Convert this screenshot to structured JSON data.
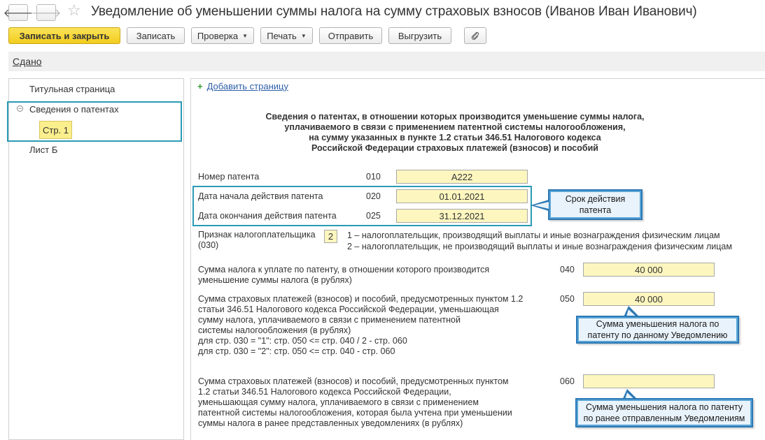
{
  "window": {
    "title": "Уведомление об уменьшении суммы налога на сумму страховых взносов (Иванов Иван Иванович)",
    "back_glyph": "🡐",
    "forward_glyph": "🡒",
    "star_glyph": "☆"
  },
  "toolbar": {
    "save_close": "Записать и закрыть",
    "save": "Записать",
    "check": "Проверка",
    "print": "Печать",
    "send": "Отправить",
    "export": "Выгрузить",
    "attach_icon": "paperclip-icon"
  },
  "status": {
    "link": "Сдано"
  },
  "nav": {
    "items": [
      {
        "label": "Титульная страница"
      },
      {
        "label": "Сведения о патентах",
        "collapse_glyph": "⊖"
      },
      {
        "label": "Стр. 1"
      },
      {
        "label": "Лист Б"
      }
    ]
  },
  "form": {
    "add_page": "Добавить страницу",
    "add_glyph": "+",
    "heading": [
      "Сведения о патентах, в отношении которых производится уменьшение суммы налога,",
      "уплачиваемого в связи с применением патентной системы налогообложения,",
      "на сумму указанных в пункте 1.2 статьи 346.51 Налогового кодекса",
      "Российской Федерации страховых платежей (взносов) и пособий"
    ],
    "patent_number": {
      "label": "Номер патента",
      "code": "010",
      "value": "А222"
    },
    "start_date": {
      "label": "Дата начала действия патента",
      "code": "020",
      "value": "01.01.2021"
    },
    "end_date": {
      "label": "Дата окончания действия патента",
      "code": "025",
      "value": "31.12.2021"
    },
    "taxpayer_sign": {
      "label_lines": [
        "Признак налогоплательщика",
        "(030)"
      ],
      "value": "2",
      "options": [
        "1 – налогоплательщик, производящий выплаты и иные вознаграждения физическим лицам",
        "2 – налогоплательщик, не производящий выплаты и иные вознаграждения физическим лицам"
      ]
    },
    "tax_sum": {
      "label_lines": [
        "Сумма налога к уплате по патенту, в отношении которого производится",
        "уменьшение суммы налога (в рублях)"
      ],
      "code": "040",
      "value": "40 000"
    },
    "insurance_sum": {
      "label_lines": [
        "Сумма страховых платежей (взносов) и пособий, предусмотренных пунктом 1.2",
        "статьи 346.51 Налогового кодекса Российской Федерации, уменьшающая",
        "сумму налога, уплачиваемого в связи с применением патентной",
        "системы налогообложения (в рублях)",
        "для стр. 030 = \"1\": стр. 050 <= стр. 040 / 2 - стр. 060",
        "для стр. 030 = \"2\": стр. 050 <= стр. 040 - стр. 060"
      ],
      "code": "050",
      "value": "40 000"
    },
    "previous_sum": {
      "label_lines": [
        "Сумма страховых платежей (взносов) и пособий, предусмотренных пунктом",
        "1.2 статьи 346.51 Налогового кодекса Российской Федерации,",
        "уменьшающая сумму налога, уплачиваемого в связи с применением",
        "патентной системы налогообложения, которая была учтена при уменьшении",
        "суммы налога в ранее представленных уведомлениях (в рублях)"
      ],
      "code": "060",
      "value": ""
    }
  },
  "callouts": {
    "validity": [
      "Срок действия",
      "патента"
    ],
    "reduction": [
      "Сумма уменьшения налога по",
      "патенту по данному Уведомлению"
    ],
    "previous": [
      "Сумма уменьшения налога по патенту",
      "по ранее отправленным Уведомлениям"
    ]
  },
  "colors": {
    "primary_button": "#f5d430",
    "field_fill": "#fdf6bf",
    "highlight_border": "#2a9bb4",
    "callout_border": "#2b78b4",
    "link": "#2d5fa8"
  }
}
